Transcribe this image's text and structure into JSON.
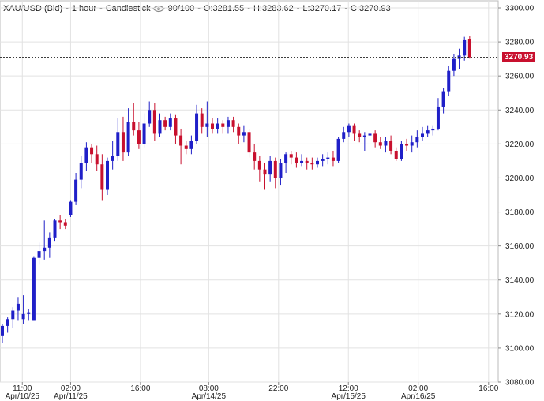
{
  "header": {
    "symbol": "XAU/USD (Bid)",
    "interval": "1 hour",
    "style": "Candlestick",
    "count": "90/100",
    "open": "O:3281.55",
    "high": "H:3283.62",
    "low": "L:3270.17",
    "close": "C:3270.93",
    "eye_icon": "eye-icon"
  },
  "last_price_tag": "3270.93",
  "colors": {
    "up": "#1f1fc8",
    "down": "#c8102e",
    "grid": "#e2e2e2",
    "tag": "#c8102e"
  },
  "chart_data": {
    "type": "candlestick",
    "ylim": [
      3080,
      3300
    ],
    "yticks": [
      "3300.00",
      "3280.00",
      "3260.00",
      "3240.00",
      "3220.00",
      "3200.00",
      "3180.00",
      "3160.00",
      "3140.00",
      "3120.00",
      "3100.00",
      "3080.00"
    ],
    "ytick_values": [
      3300,
      3280,
      3260,
      3240,
      3220,
      3200,
      3180,
      3160,
      3140,
      3120,
      3100,
      3080
    ],
    "xticks": [
      {
        "time": "11:00",
        "date": "Apr/10/25",
        "index": 3.8
      },
      {
        "time": "02:00",
        "date": "Apr/11/25",
        "index": 13.0
      },
      {
        "time": "16:00",
        "date": "",
        "index": 26.3
      },
      {
        "time": "08:00",
        "date": "Apr/14/25",
        "index": 39.3
      },
      {
        "time": "22:00",
        "date": "",
        "index": 52.6
      },
      {
        "time": "12:00",
        "date": "Apr/15/25",
        "index": 65.9
      },
      {
        "time": "02:00",
        "date": "Apr/16/25",
        "index": 79.2
      },
      {
        "time": "16:00",
        "date": "",
        "index": 92.6
      }
    ],
    "last_price": 3270.93,
    "candles": [
      [
        3107,
        3113,
        3103,
        3114
      ],
      [
        3113,
        3117,
        3109,
        3118
      ],
      [
        3117,
        3122,
        3112,
        3124
      ],
      [
        3122,
        3126,
        3116,
        3130
      ],
      [
        3117,
        3120,
        3114,
        3131
      ],
      [
        3120,
        3121,
        3116,
        3123
      ],
      [
        3116,
        3153,
        3116,
        3154
      ],
      [
        3153,
        3157,
        3149,
        3162
      ],
      [
        3157,
        3159,
        3152,
        3175
      ],
      [
        3159,
        3165,
        3153,
        3168
      ],
      [
        3165,
        3175,
        3163,
        3176
      ],
      [
        3175,
        3174,
        3170,
        3178
      ],
      [
        3174,
        3172,
        3170,
        3176
      ],
      [
        3178,
        3186,
        3177,
        3187
      ],
      [
        3186,
        3199,
        3184,
        3203
      ],
      [
        3199,
        3209,
        3194,
        3213
      ],
      [
        3209,
        3218,
        3204,
        3221
      ],
      [
        3218,
        3214,
        3209,
        3220
      ],
      [
        3214,
        3208,
        3204,
        3219
      ],
      [
        3208,
        3193,
        3187,
        3214
      ],
      [
        3193,
        3210,
        3190,
        3212
      ],
      [
        3210,
        3213,
        3205,
        3222
      ],
      [
        3213,
        3227,
        3210,
        3235
      ],
      [
        3227,
        3215,
        3210,
        3236
      ],
      [
        3215,
        3233,
        3213,
        3241
      ],
      [
        3233,
        3228,
        3225,
        3244
      ],
      [
        3228,
        3220,
        3217,
        3233
      ],
      [
        3220,
        3232,
        3218,
        3238
      ],
      [
        3232,
        3240,
        3230,
        3245
      ],
      [
        3240,
        3226,
        3222,
        3244
      ],
      [
        3226,
        3234,
        3224,
        3238
      ],
      [
        3234,
        3230,
        3228,
        3236
      ],
      [
        3230,
        3235,
        3228,
        3238
      ],
      [
        3235,
        3225,
        3220,
        3237
      ],
      [
        3225,
        3219,
        3208,
        3229
      ],
      [
        3219,
        3217,
        3214,
        3222
      ],
      [
        3217,
        3222,
        3214,
        3225
      ],
      [
        3222,
        3238,
        3220,
        3243
      ],
      [
        3238,
        3230,
        3226,
        3241
      ],
      [
        3230,
        3232,
        3224,
        3245
      ],
      [
        3232,
        3229,
        3226,
        3235
      ],
      [
        3229,
        3232,
        3226,
        3235
      ],
      [
        3232,
        3230,
        3226,
        3234
      ],
      [
        3230,
        3234,
        3226,
        3236
      ],
      [
        3234,
        3230,
        3227,
        3236
      ],
      [
        3230,
        3225,
        3220,
        3232
      ],
      [
        3225,
        3227,
        3221,
        3231
      ],
      [
        3227,
        3215,
        3212,
        3229
      ],
      [
        3215,
        3210,
        3205,
        3220
      ],
      [
        3210,
        3205,
        3198,
        3213
      ],
      [
        3205,
        3202,
        3193,
        3209
      ],
      [
        3202,
        3210,
        3198,
        3213
      ],
      [
        3210,
        3200,
        3194,
        3212
      ],
      [
        3200,
        3209,
        3196,
        3211
      ],
      [
        3209,
        3214,
        3203,
        3215
      ],
      [
        3214,
        3212,
        3208,
        3216
      ],
      [
        3212,
        3209,
        3206,
        3215
      ],
      [
        3209,
        3210,
        3207,
        3214
      ],
      [
        3210,
        3209,
        3205,
        3212
      ],
      [
        3209,
        3208,
        3205,
        3212
      ],
      [
        3208,
        3210,
        3206,
        3212
      ],
      [
        3210,
        3211,
        3207,
        3214
      ],
      [
        3211,
        3212,
        3208,
        3215
      ],
      [
        3212,
        3210,
        3207,
        3216
      ],
      [
        3210,
        3223,
        3209,
        3224
      ],
      [
        3223,
        3227,
        3221,
        3230
      ],
      [
        3227,
        3231,
        3224,
        3232
      ],
      [
        3231,
        3226,
        3222,
        3232
      ],
      [
        3226,
        3224,
        3221,
        3228
      ],
      [
        3224,
        3225,
        3216,
        3227
      ],
      [
        3225,
        3226,
        3223,
        3228
      ],
      [
        3226,
        3221,
        3218,
        3228
      ],
      [
        3221,
        3219,
        3217,
        3224
      ],
      [
        3219,
        3222,
        3215,
        3224
      ],
      [
        3222,
        3216,
        3214,
        3225
      ],
      [
        3216,
        3211,
        3210,
        3218
      ],
      [
        3211,
        3220,
        3210,
        3222
      ],
      [
        3220,
        3219,
        3216,
        3223
      ],
      [
        3219,
        3221,
        3215,
        3225
      ],
      [
        3221,
        3224,
        3218,
        3228
      ],
      [
        3224,
        3226,
        3222,
        3230
      ],
      [
        3226,
        3228,
        3224,
        3231
      ],
      [
        3228,
        3229,
        3225,
        3231
      ],
      [
        3229,
        3242,
        3228,
        3247
      ],
      [
        3242,
        3251,
        3238,
        3253
      ],
      [
        3251,
        3263,
        3248,
        3266
      ],
      [
        3263,
        3270,
        3260,
        3273
      ],
      [
        3270,
        3272,
        3264,
        3276
      ],
      [
        3272,
        3281,
        3269,
        3283
      ],
      [
        3281.55,
        3270.93,
        3270.17,
        3283.62
      ]
    ]
  }
}
